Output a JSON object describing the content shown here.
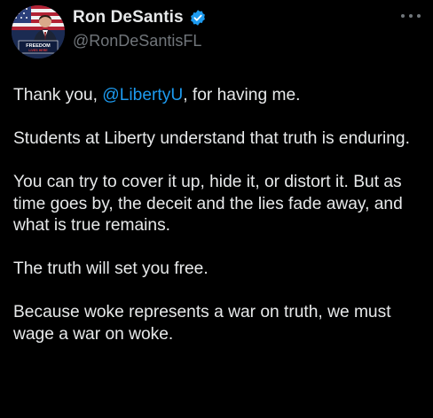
{
  "author": {
    "display_name": "Ron DeSantis",
    "handle": "@RonDeSantisFL",
    "avatar_sign_text": "FREEDOM",
    "avatar_sign_subtext": "LIVES HERE",
    "verified_color": "#1d9bf0"
  },
  "menu": {
    "icon": "more-icon"
  },
  "tweet": {
    "p1_before": "Thank you, ",
    "p1_mention": "@LibertyU",
    "p1_after": ", for having me.",
    "p2": "Students at Liberty understand that truth is enduring.",
    "p3": "You can try to cover it up, hide it, or distort it. But as time goes by, the deceit and the lies fade away, and what is true remains.",
    "p4": "The truth will set you free.",
    "p5": "Because woke represents a war on truth, we must wage a war on woke."
  },
  "colors": {
    "background": "#000000",
    "text": "#e7e9ea",
    "secondary": "#71767b",
    "link": "#1d9bf0"
  }
}
